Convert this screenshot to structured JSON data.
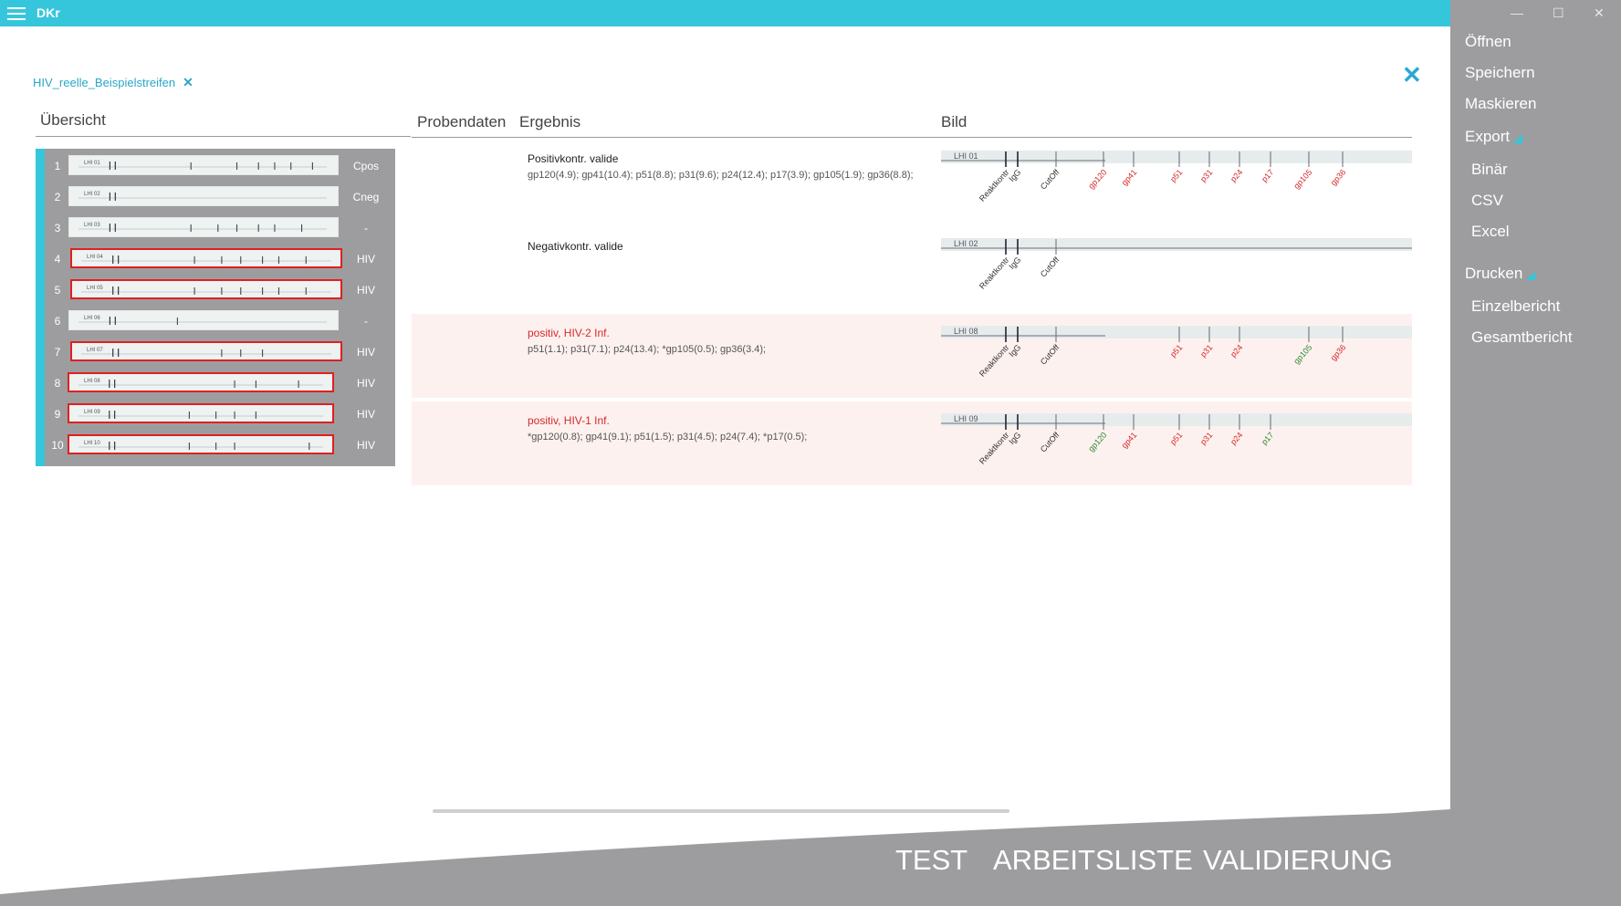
{
  "app": {
    "title": "DKr",
    "document_tab": "HIV_reelle_Beispielstreifen",
    "colors": {
      "accent": "#36c6dc",
      "positive_text": "#d42a2a",
      "panel_gray": "#9d9d9f",
      "flag_red": "#e02020"
    }
  },
  "headers": {
    "overview": "Übersicht",
    "probendaten": "Probendaten",
    "ergebnis": "Ergebnis",
    "bild": "Bild"
  },
  "overview": {
    "rows": [
      {
        "num": "1",
        "code": "LHI 01",
        "label": "Cpos",
        "flagged": false
      },
      {
        "num": "2",
        "code": "LHI 02",
        "label": "Cneg",
        "flagged": false
      },
      {
        "num": "3",
        "code": "LHI 03",
        "label": "-",
        "flagged": false
      },
      {
        "num": "4",
        "code": "LHI 04",
        "label": "HIV",
        "flagged": true
      },
      {
        "num": "5",
        "code": "LHI 05",
        "label": "HIV",
        "flagged": true
      },
      {
        "num": "6",
        "code": "LHI 06",
        "label": "-",
        "flagged": false
      },
      {
        "num": "7",
        "code": "LHI 07",
        "label": "HIV",
        "flagged": true
      },
      {
        "num": "8",
        "code": "LHI 08",
        "label": "HIV",
        "flagged": true
      },
      {
        "num": "9",
        "code": "LHI 09",
        "label": "HIV",
        "flagged": true
      },
      {
        "num": "10",
        "code": "LHI 10",
        "label": "HIV",
        "flagged": true
      }
    ]
  },
  "results": [
    {
      "status": "Positivkontr. valide",
      "positive": false,
      "values": "gp120(4.9); gp41(10.4); p51(8.8); p31(9.6); p24(12.4); p17(3.9); gp105(1.9); gp36(8.8);",
      "strip_code": "LHI 01"
    },
    {
      "status": "Negativkontr. valide",
      "positive": false,
      "values": "",
      "strip_code": "LHI 02"
    },
    {
      "status": "positiv, HIV-2 Inf.",
      "positive": true,
      "values": "p51(1.1); p31(7.1); p24(13.4); *gp105(0.5); gp36(3.4);",
      "strip_code": "LHI 08"
    },
    {
      "status": "positiv, HIV-1 Inf.",
      "positive": true,
      "values": "*gp120(0.8); gp41(9.1); p51(1.5); p31(4.5); p24(7.4); *p17(0.5);",
      "strip_code": "LHI 09"
    }
  ],
  "band_labels": [
    "Reaktkontr",
    "IgG",
    "CutOff",
    "gp120",
    "gp41",
    "p51",
    "p31",
    "p24",
    "p17",
    "gp105",
    "gp36"
  ],
  "sidebar": {
    "items": [
      "Öffnen",
      "Speichern",
      "Maskieren",
      "Export",
      "Binär",
      "CSV",
      "Excel",
      "Drucken",
      "Einzelbericht",
      "Gesamtbericht"
    ]
  },
  "bottom_nav": [
    "TEST",
    "ARBEITSLISTE",
    "VALIDIERUNG"
  ]
}
